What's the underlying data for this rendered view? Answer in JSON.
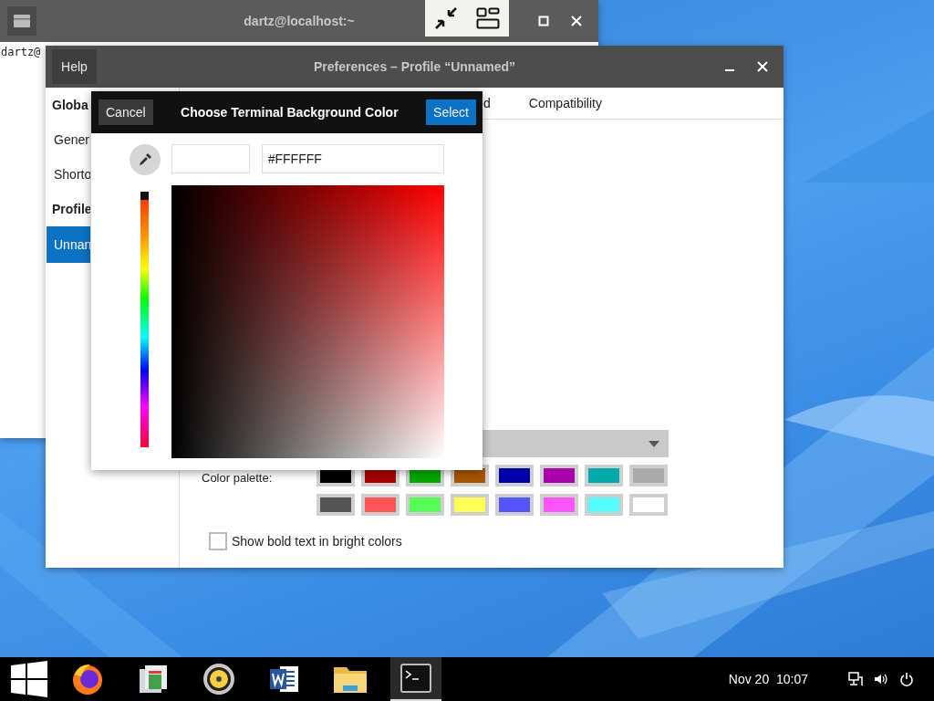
{
  "terminal": {
    "title": "dartz@localhost:~",
    "prompt": "dartz@"
  },
  "preferences": {
    "help": "Help",
    "title": "Preferences – Profile “Unnamed”",
    "sidebar": [
      {
        "label": "Globa",
        "kind": "heading",
        "selected": false
      },
      {
        "label": "Gener",
        "kind": "item",
        "selected": false
      },
      {
        "label": "Shorto",
        "kind": "item",
        "selected": false
      },
      {
        "label": "Profile",
        "kind": "heading",
        "selected": false
      },
      {
        "label": "Unnan",
        "kind": "item",
        "selected": true
      }
    ],
    "tabs": [
      {
        "label": "d"
      },
      {
        "label": "Compatibility"
      }
    ],
    "palette_label": "Color palette:",
    "palette": [
      {
        "color": "#000000"
      },
      {
        "color": "#aa0000"
      },
      {
        "color": "#00aa00"
      },
      {
        "color": "#aa5500"
      },
      {
        "color": "#0000aa"
      },
      {
        "color": "#aa00aa"
      },
      {
        "color": "#00aaaa"
      },
      {
        "color": "#aaaaaa"
      },
      {
        "color": "#555555"
      },
      {
        "color": "#ff5555"
      },
      {
        "color": "#55ff55"
      },
      {
        "color": "#ffff55"
      },
      {
        "color": "#5555ff"
      },
      {
        "color": "#ff55ff"
      },
      {
        "color": "#55ffff"
      },
      {
        "color": "#ffffff"
      }
    ],
    "bold_bright": {
      "label": "Show bold text in bright colors",
      "checked": false
    }
  },
  "color_dialog": {
    "cancel": "Cancel",
    "title": "Choose Terminal Background Color",
    "select": "Select",
    "hex": "#FFFFFF",
    "hue_slider": {
      "level": 0
    }
  },
  "taskbar": {
    "apps": [
      {
        "kind": "firefox",
        "selected": false
      },
      {
        "kind": "mail",
        "selected": false
      },
      {
        "kind": "speaker",
        "selected": false
      },
      {
        "kind": "word",
        "selected": false
      },
      {
        "kind": "folder",
        "selected": false
      },
      {
        "kind": "terminal",
        "selected": true
      }
    ],
    "date": "Nov 20",
    "time": "10:07"
  }
}
